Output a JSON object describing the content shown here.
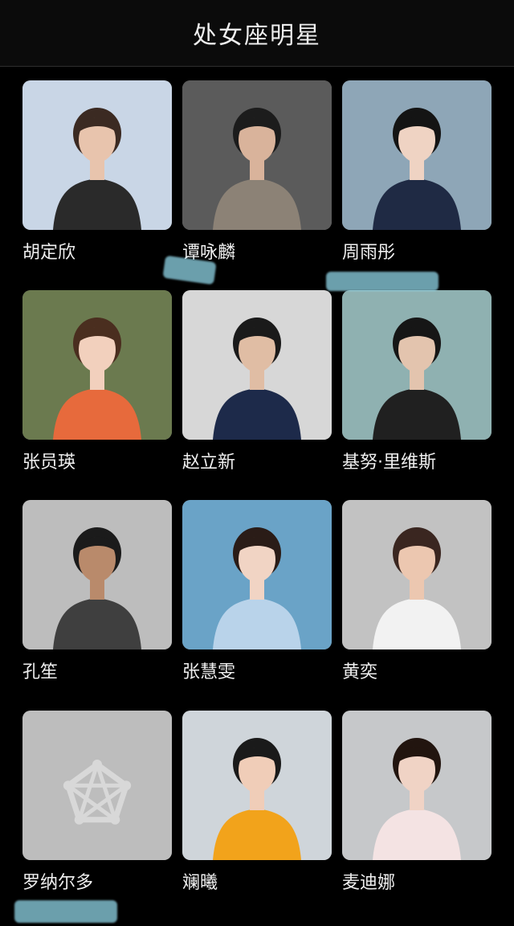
{
  "header": {
    "title": "处女座明星"
  },
  "celebrities": [
    {
      "name": "胡定欣",
      "bg": "#c9d6e6",
      "figure": "#2a2a2a",
      "skin": "#e8c4ad",
      "hair": "#3b2a22"
    },
    {
      "name": "谭咏麟",
      "bg": "#5b5b5b",
      "figure": "#8c8276",
      "skin": "#d9b39b",
      "hair": "#1c1c1c"
    },
    {
      "name": "周雨彤",
      "bg": "#8ea6b7",
      "figure": "#1f2a44",
      "skin": "#efd3c3",
      "hair": "#141414"
    },
    {
      "name": "张员瑛",
      "bg": "#6b7a4f",
      "figure": "#e76a3c",
      "skin": "#f2d0bd",
      "hair": "#4a2e1f"
    },
    {
      "name": "赵立新",
      "bg": "#d7d7d7",
      "figure": "#1d2a4a",
      "skin": "#e0bda4",
      "hair": "#1a1a1a"
    },
    {
      "name": "基努·里维斯",
      "bg": "#8fb1b1",
      "figure": "#202020",
      "skin": "#e3c4ae",
      "hair": "#161616"
    },
    {
      "name": "孔笙",
      "bg": "#bdbdbd",
      "figure": "#3f3f3f",
      "skin": "#b98a6b",
      "hair": "#1b1b1b"
    },
    {
      "name": "张慧雯",
      "bg": "#6aa3c7",
      "figure": "#b9d3ea",
      "skin": "#f1d4c4",
      "hair": "#2a1c17"
    },
    {
      "name": "黄奕",
      "bg": "#c2c2c2",
      "figure": "#f2f2f2",
      "skin": "#ecc7b0",
      "hair": "#3a2620"
    },
    {
      "name": "罗纳尔多",
      "bg": "#bdbdbd",
      "figure": "#d6d6d6",
      "skin": "#d6d6d6",
      "hair": "#bdbdbd",
      "placeholder": true
    },
    {
      "name": "斓曦",
      "bg": "#cfd5da",
      "figure": "#f2a31b",
      "skin": "#f0cdb8",
      "hair": "#1a1a1a"
    },
    {
      "name": "麦迪娜",
      "bg": "#c6c8ca",
      "figure": "#f4e3e3",
      "skin": "#f0d3c5",
      "hair": "#22150f"
    }
  ],
  "colors": {
    "background": "#000000",
    "header_bg": "#0b0b0b",
    "name_text": "#efefef",
    "smudge": "#8fd4e6"
  },
  "icons": {
    "placeholder": "star-placeholder-icon"
  }
}
